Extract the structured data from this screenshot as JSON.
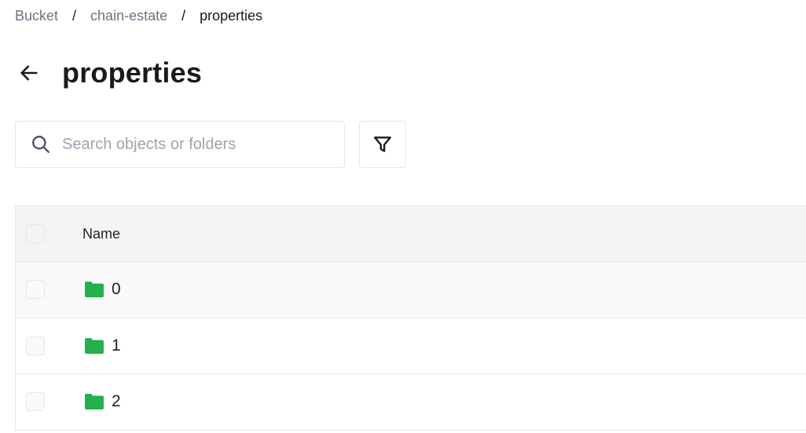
{
  "breadcrumb": {
    "items": [
      {
        "label": "Bucket"
      },
      {
        "label": "chain-estate"
      },
      {
        "label": "properties"
      }
    ],
    "separator": "/"
  },
  "header": {
    "title": "properties",
    "back_icon": "arrow-left-icon"
  },
  "search": {
    "placeholder": "Search objects or folders",
    "value": "",
    "icon": "search-icon"
  },
  "filter": {
    "icon": "filter-icon"
  },
  "table": {
    "columns": [
      {
        "label": "Name"
      }
    ],
    "rows": [
      {
        "name": "0",
        "type": "folder"
      },
      {
        "name": "1",
        "type": "folder"
      },
      {
        "name": "2",
        "type": "folder"
      }
    ]
  },
  "colors": {
    "folder": "#22b14c",
    "border": "#e5e7eb",
    "header_bg": "#f4f4f4",
    "muted_text": "#6b7280"
  }
}
